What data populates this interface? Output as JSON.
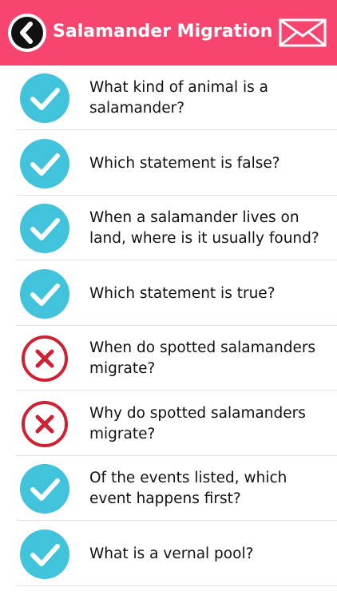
{
  "header": {
    "title": "Salamander Migration",
    "background_color": "#f7456f",
    "back_icon": "chevron-left-icon",
    "mail_icon": "envelope-icon"
  },
  "colors": {
    "correct": "#42c3dc",
    "incorrect": "#cc2233"
  },
  "questions": [
    {
      "text": "What kind of animal is a salamander?",
      "status": "correct"
    },
    {
      "text": "Which statement is false?",
      "status": "correct"
    },
    {
      "text": "When a salamander lives on land, where is it usually found?",
      "status": "correct"
    },
    {
      "text": "Which statement is true?",
      "status": "correct"
    },
    {
      "text": "When do spotted salamanders migrate?",
      "status": "incorrect"
    },
    {
      "text": "Why do spotted salamanders migrate?",
      "status": "incorrect"
    },
    {
      "text": "Of the events listed, which event happens first?",
      "status": "correct"
    },
    {
      "text": "What is a vernal pool?",
      "status": "correct"
    }
  ]
}
